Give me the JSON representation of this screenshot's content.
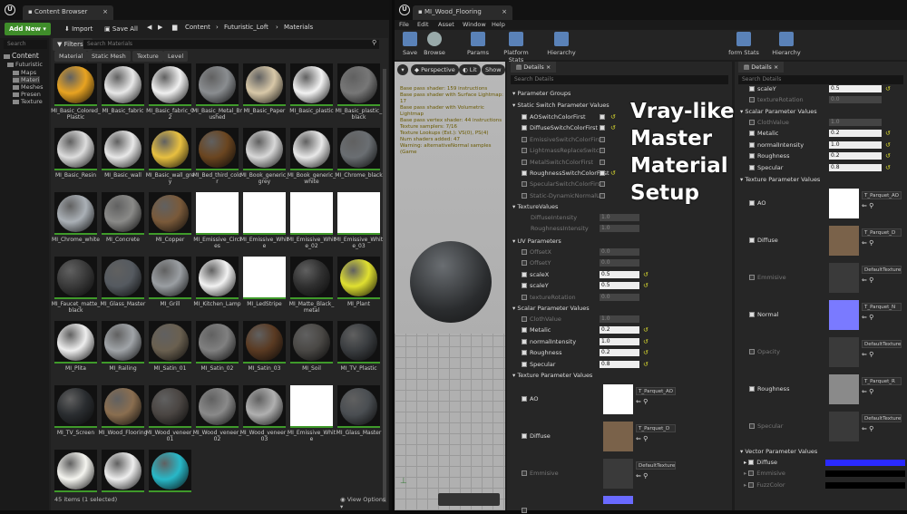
{
  "content_browser": {
    "tab_title": "Content Browser",
    "add_new": "Add New",
    "import": "Import",
    "save_all": "Save All",
    "breadcrumb": [
      "Content",
      "Futuristic_Loft",
      "Materials"
    ],
    "search_placeholder": "Search",
    "filters_label": "Filters",
    "search_materials_placeholder": "Search Materials",
    "filter_tabs": [
      "Material",
      "Static Mesh",
      "Texture",
      "Level"
    ],
    "tree": [
      "Content",
      "Futuristic",
      "Maps",
      "Materi",
      "Meshes",
      "Presen",
      "Texture"
    ],
    "assets": [
      {
        "label": "MI_Basic_Colored_Plastic",
        "color": "#e8a321"
      },
      {
        "label": "MI_Basic_fabric",
        "color": "#e8e8e8"
      },
      {
        "label": "MI_Basic_fabric_02",
        "color": "#f0f0f0"
      },
      {
        "label": "MI_Basic_Metal_Brushed",
        "color": "#8a8d90"
      },
      {
        "label": "MI_Basic_Paper",
        "color": "#d8c8a8"
      },
      {
        "label": "MI_Basic_plastic",
        "color": "#f2f2f2"
      },
      {
        "label": "MI_Basic_plastic_black",
        "color": "#777777"
      },
      {
        "label": "MI_Basic_Resin",
        "color": "#dddddd"
      },
      {
        "label": "MI_Basic_wall",
        "color": "#e8e8e8"
      },
      {
        "label": "MI_Basic_wall_grey",
        "color": "#e8c040"
      },
      {
        "label": "MI_Bed_third_color",
        "color": "#6a4520"
      },
      {
        "label": "MI_Book_generic_grey",
        "color": "#d8d8d8"
      },
      {
        "label": "MI_Book_generic_white",
        "color": "#e8e8e8"
      },
      {
        "label": "MI_Chrome_black",
        "color": "#6a6e72"
      },
      {
        "label": "MI_Chrome_white",
        "color": "#aab0b6"
      },
      {
        "label": "MI_Concrete",
        "color": "#8a8a88"
      },
      {
        "label": "MI_Copper",
        "color": "#7a5a3a"
      },
      {
        "label": "MI_Emissive_Circles",
        "color": "#ffffff"
      },
      {
        "label": "MI_Emissive_White",
        "color": "#ffffff"
      },
      {
        "label": "MI_Emissive_White_02",
        "color": "#ffffff"
      },
      {
        "label": "MI_Emissive_White_03",
        "color": "#ffffff"
      },
      {
        "label": "MI_Faucet_matte_black",
        "color": "#3a3a3a"
      },
      {
        "label": "MI_Glass_Master",
        "color": "#555a60"
      },
      {
        "label": "MI_Grill",
        "color": "#9a9ea2"
      },
      {
        "label": "MI_Kitchen_Lamp",
        "color": "#f2f2f2"
      },
      {
        "label": "MI_LedStripe",
        "color": "#ffffff"
      },
      {
        "label": "MI_Matte_Black_metal",
        "color": "#303030"
      },
      {
        "label": "MI_Plant",
        "color": "#e0e030"
      },
      {
        "label": "MI_Plita",
        "color": "#eeeeee"
      },
      {
        "label": "MI_Railing",
        "color": "#a0a4a8"
      },
      {
        "label": "MI_Satin_01",
        "color": "#6a6050"
      },
      {
        "label": "MI_Satin_02",
        "color": "#808080"
      },
      {
        "label": "MI_Satin_03",
        "color": "#5a3a22"
      },
      {
        "label": "MI_Soil",
        "color": "#4a4845"
      },
      {
        "label": "MI_TV_Plastic",
        "color": "#3a3d40"
      },
      {
        "label": "MI_TV_Screen",
        "color": "#2a2d30"
      },
      {
        "label": "MI_Wood_Flooring",
        "color": "#8a6e50"
      },
      {
        "label": "MI_Wood_veneer_01",
        "color": "#4a4542"
      },
      {
        "label": "MI_Wood_veneer_02",
        "color": "#8a8a8a"
      },
      {
        "label": "MI_Wood_veneer_03",
        "color": "#b0b0b0"
      },
      {
        "label": "MI_Emissive_White",
        "color": "#ffffff"
      },
      {
        "label": "MI_Glass_Master",
        "color": "#4a4e52"
      },
      {
        "label": "",
        "color": "#f5f5f0"
      },
      {
        "label": "",
        "color": "#eeeeee"
      },
      {
        "label": "",
        "color": "#28b8c8"
      }
    ],
    "status": "45 items (1 selected)",
    "view_options": "View Options"
  },
  "material_editor": {
    "tab_title": "MI_Wood_Flooring",
    "menu": [
      "File",
      "Edit",
      "Asset",
      "Window",
      "Help"
    ],
    "toolbar": [
      "Save",
      "Browse",
      "Params",
      "Platform Stats",
      "Hierarchy",
      "form Stats",
      "Hierarchy"
    ],
    "viewport_buttons": [
      "Perspective",
      "Lit",
      "Show"
    ],
    "stats": [
      "Base pass shader: 159 instructions",
      "Base pass shader with Surface Lightmap: 17",
      "Base pass shader with Volumetric Lightmap",
      "Base pass vertex shader: 44 instructions",
      "Texture samplers: 7/16",
      "Texture Lookups (Est.): VS(0), PS(4)",
      "Num shaders added: 47",
      "Warning: alternativeNormal samples (Game"
    ],
    "details_tab": "Details",
    "details_search": "Search Details",
    "overlay_text": [
      "Vray-like",
      "Master",
      "Material",
      "Setup"
    ]
  },
  "details_a": {
    "parameter_groups": "Parameter Groups",
    "static_switch": "Static Switch Parameter Values",
    "switches": [
      {
        "label": "AOSwitchColorFirst",
        "on": true
      },
      {
        "label": "DiffuseSwitchColorFirst",
        "on": true
      },
      {
        "label": "EmissiveSwitchColorFirst",
        "on": false
      },
      {
        "label": "LightmassReplaceSwitch",
        "on": false
      },
      {
        "label": "MetalSwitchColorFirst",
        "on": false
      },
      {
        "label": "RoughnessSwitchColorFirst",
        "on": true
      },
      {
        "label": "SpecularSwitchColorFirst",
        "on": false
      },
      {
        "label": "Static-DynamicNormalUV",
        "on": false
      }
    ],
    "texture_values": "TextureValues",
    "texture_values_rows": [
      {
        "label": "DiffuseIntensity",
        "value": "1.0"
      },
      {
        "label": "RoughnessIntensity",
        "value": "1.0"
      }
    ],
    "uv_parameters": "UV Parameters",
    "uv_rows": [
      {
        "label": "OffsetX",
        "value": "0.0",
        "on": false
      },
      {
        "label": "OffsetY",
        "value": "0.0",
        "on": false
      },
      {
        "label": "scaleX",
        "value": "0.5",
        "on": true
      },
      {
        "label": "scaleY",
        "value": "0.5",
        "on": true
      },
      {
        "label": "textureRotation",
        "value": "0.0",
        "on": false
      }
    ],
    "scalar_parameters": "Scalar Parameter Values",
    "scalar_rows": [
      {
        "label": "ClothValue",
        "value": "1.0",
        "on": false
      },
      {
        "label": "Metalic",
        "value": "0.2",
        "on": true
      },
      {
        "label": "normalIntensity",
        "value": "1.0",
        "on": true
      },
      {
        "label": "Roughness",
        "value": "0.2",
        "on": true
      },
      {
        "label": "Specular",
        "value": "0.8",
        "on": true
      }
    ],
    "texture_parameters": "Texture Parameter Values",
    "texture_rows": [
      {
        "label": "AO",
        "tex": "T_Parquet_AO",
        "swatch": "#ffffff",
        "on": true
      },
      {
        "label": "Diffuse",
        "tex": "T_Parquet_D",
        "swatch": "#7a624a",
        "on": true
      },
      {
        "label": "Emmisive",
        "tex": "DefaultTexture",
        "swatch": "#3a3a3a",
        "on": false
      },
      {
        "label": "",
        "tex": "",
        "swatch": "#6a6aff",
        "on": false
      }
    ]
  },
  "details_b": {
    "rows_top": [
      {
        "label": "scaleY",
        "value": "0.5",
        "on": true
      },
      {
        "label": "textureRotation",
        "value": "0.0",
        "on": false
      }
    ],
    "scalar_parameters": "Scalar Parameter Values",
    "scalar_rows": [
      {
        "label": "ClothValue",
        "value": "1.0",
        "on": false
      },
      {
        "label": "Metalic",
        "value": "0.2",
        "on": true
      },
      {
        "label": "normalIntensity",
        "value": "1.0",
        "on": true
      },
      {
        "label": "Roughness",
        "value": "0.2",
        "on": true
      },
      {
        "label": "Specular",
        "value": "0.8",
        "on": true
      }
    ],
    "texture_parameters": "Texture Parameter Values",
    "texture_rows": [
      {
        "label": "AO",
        "tex": "T_Parquet_AO",
        "swatch": "#ffffff",
        "on": true
      },
      {
        "label": "Diffuse",
        "tex": "T_Parquet_D",
        "swatch": "#7a624a",
        "on": true
      },
      {
        "label": "Emmisive",
        "tex": "DefaultTexture",
        "swatch": "#3a3a3a",
        "on": false
      },
      {
        "label": "Normal",
        "tex": "T_Parquet_N",
        "swatch": "#7a7aff",
        "on": true
      },
      {
        "label": "Opacity",
        "tex": "DefaultTexture",
        "swatch": "#3a3a3a",
        "on": false
      },
      {
        "label": "Roughness",
        "tex": "T_Parquet_R",
        "swatch": "#8a8a8a",
        "on": true
      },
      {
        "label": "Specular",
        "tex": "DefaultTexture",
        "swatch": "#3a3a3a",
        "on": false
      }
    ],
    "vector_parameters": "Vector Parameter Values",
    "vector_rows": [
      {
        "label": "Diffuse",
        "on": true,
        "color": "#2a2aff"
      },
      {
        "label": "Emmisive",
        "on": false,
        "color": "#000000"
      },
      {
        "label": "FuzzColor",
        "on": false,
        "color": "#000000"
      }
    ]
  }
}
